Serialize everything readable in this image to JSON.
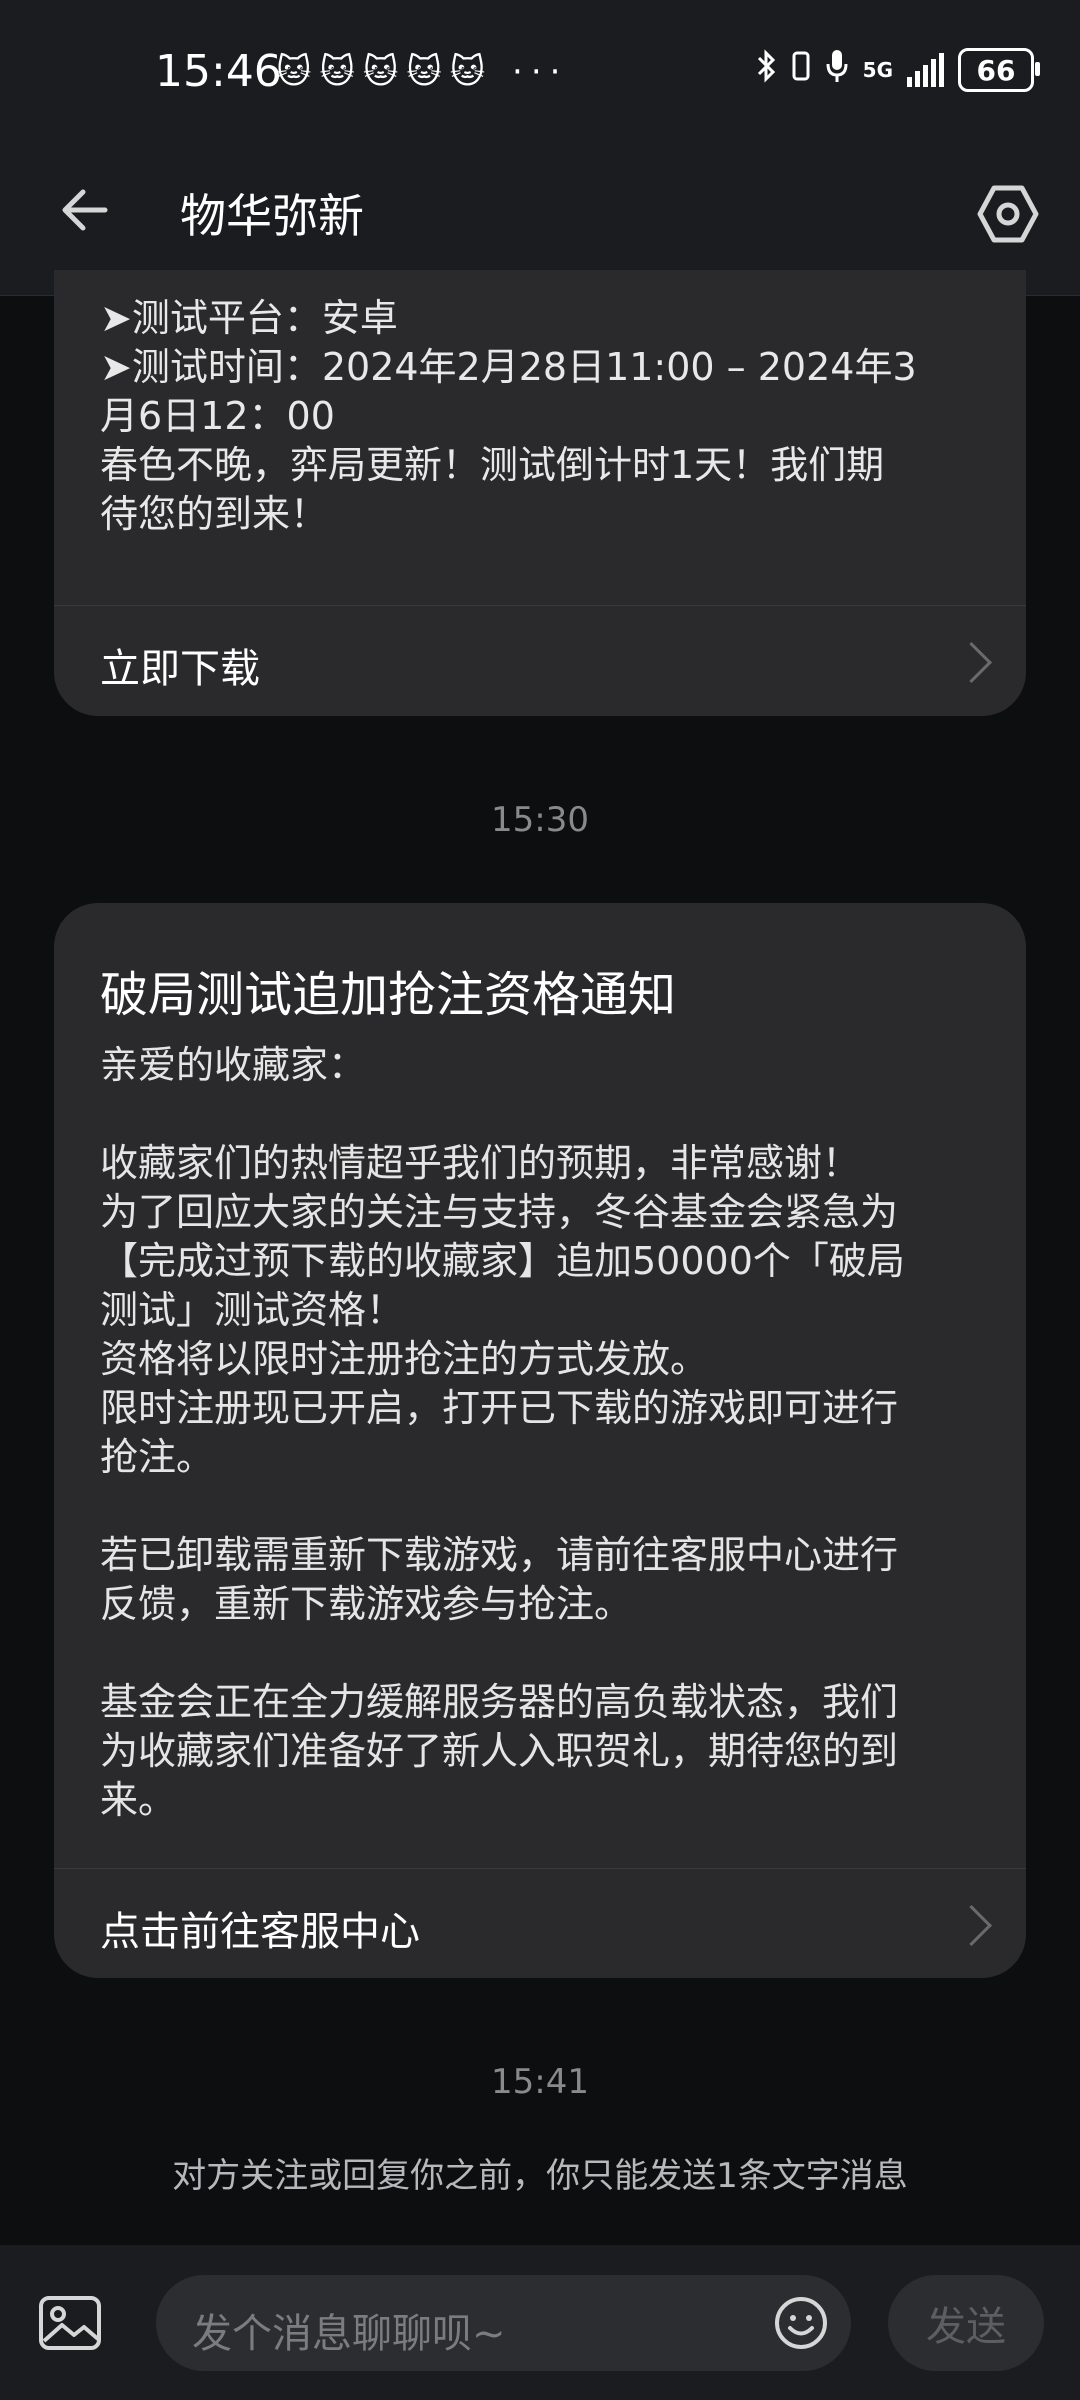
{
  "status_bar": {
    "time": "15:46",
    "notification_icons": "🐱🐱🐱🐱🐱 ···",
    "network": "5G",
    "battery": "66"
  },
  "header": {
    "title": "物华弥新"
  },
  "card1": {
    "lines": [
      "➤测试平台：安卓",
      "➤测试时间：2024年2月28日11:00 – 2024年3",
      "月6日12：00",
      "春色不晚，弈局更新！测试倒计时1天！我们期",
      "待您的到来！"
    ],
    "action": "立即下载"
  },
  "timestamp1": "15:30",
  "card2": {
    "title": "破局测试追加抢注资格通知",
    "greeting": "亲爱的收藏家：",
    "p1": "收藏家们的热情超乎我们的预期，非常感谢！\n为了回应大家的关注与支持，冬谷基金会紧急为\n【完成过预下载的收藏家】追加50000个「破局\n测试」测试资格！\n资格将以限时注册抢注的方式发放。\n限时注册现已开启，打开已下载的游戏即可进行\n抢注。",
    "p2": "若已卸载需重新下载游戏，请前往客服中心进行\n反馈，重新下载游戏参与抢注。",
    "p3": "基金会正在全力缓解服务器的高负载状态，我们\n为收藏家们准备好了新人入职贺礼，期待您的到\n来。",
    "action": "点击前往客服中心"
  },
  "timestamp2": "15:41",
  "notice": "对方关注或回复你之前，你只能发送1条文字消息",
  "composer": {
    "placeholder": "发个消息聊聊呗~",
    "send_label": "发送"
  },
  "colors": {
    "background": "#0d0e10",
    "bar": "#1b1c1f",
    "card": "#2a2a2c",
    "muted": "#8a8a8d"
  }
}
